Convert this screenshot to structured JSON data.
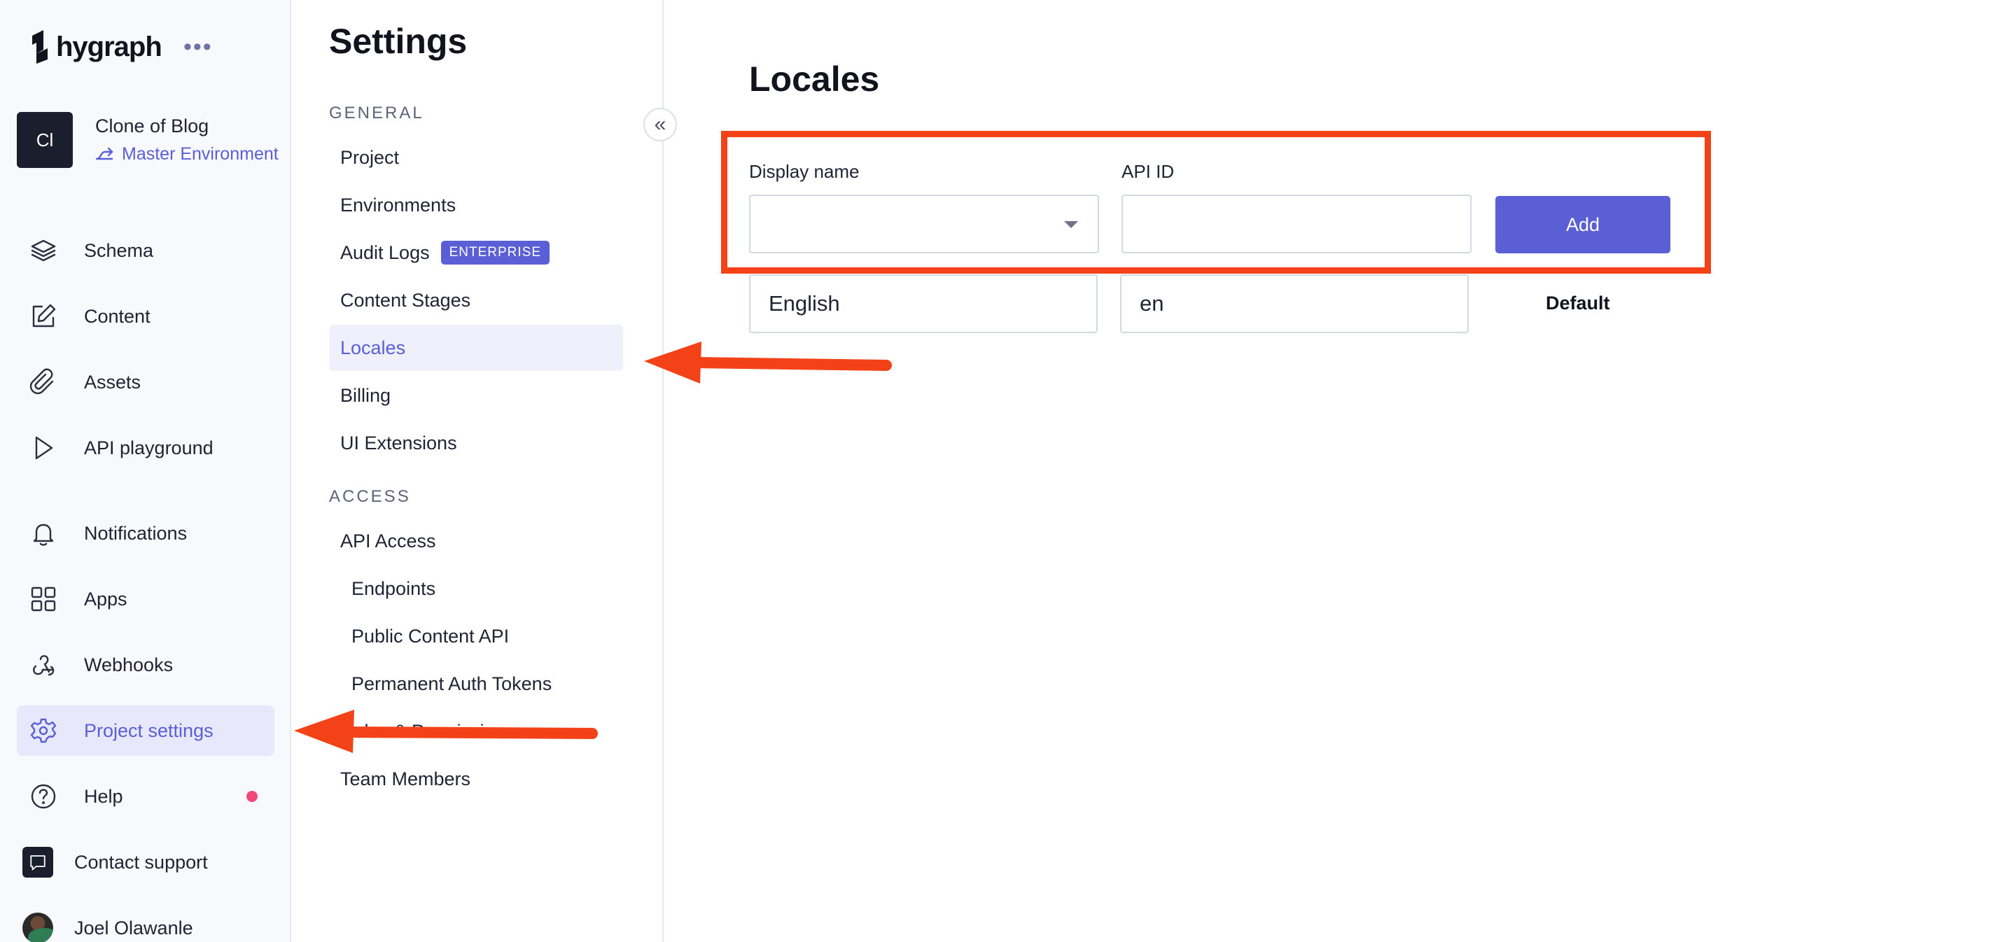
{
  "brand": {
    "logo_text": "hygraph",
    "more_glyph": "•••"
  },
  "project": {
    "avatar_initials": "Cl",
    "name": "Clone of Blog",
    "environment": "Master Environment"
  },
  "nav": {
    "schema": "Schema",
    "content": "Content",
    "assets": "Assets",
    "api_playground": "API playground",
    "notifications": "Notifications",
    "apps": "Apps",
    "webhooks": "Webhooks",
    "project_settings": "Project settings",
    "help": "Help",
    "contact_support": "Contact support",
    "user_name": "Joel Olawanle"
  },
  "settings": {
    "title": "Settings",
    "general_label": "GENERAL",
    "project": "Project",
    "environments": "Environments",
    "audit_logs": "Audit Logs",
    "enterprise_badge": "ENTERPRISE",
    "content_stages": "Content Stages",
    "locales": "Locales",
    "billing": "Billing",
    "ui_extensions": "UI Extensions",
    "access_label": "ACCESS",
    "api_access": "API Access",
    "endpoints": "Endpoints",
    "public_content_api": "Public Content API",
    "permanent_auth_tokens": "Permanent Auth Tokens",
    "roles_permissions": "Roles & Permissions",
    "team_members": "Team Members",
    "collapse_glyph": "«"
  },
  "locales_page": {
    "title": "Locales",
    "display_name_label": "Display name",
    "api_id_label": "API ID",
    "display_name_value": "",
    "api_id_value": "",
    "add_label": "Add",
    "rows": [
      {
        "display_name": "English",
        "api_id": "en",
        "status": "Default"
      }
    ]
  },
  "colors": {
    "accent": "#5a5fd6",
    "annotation": "#f44218",
    "help_dot": "#f04a7a"
  }
}
